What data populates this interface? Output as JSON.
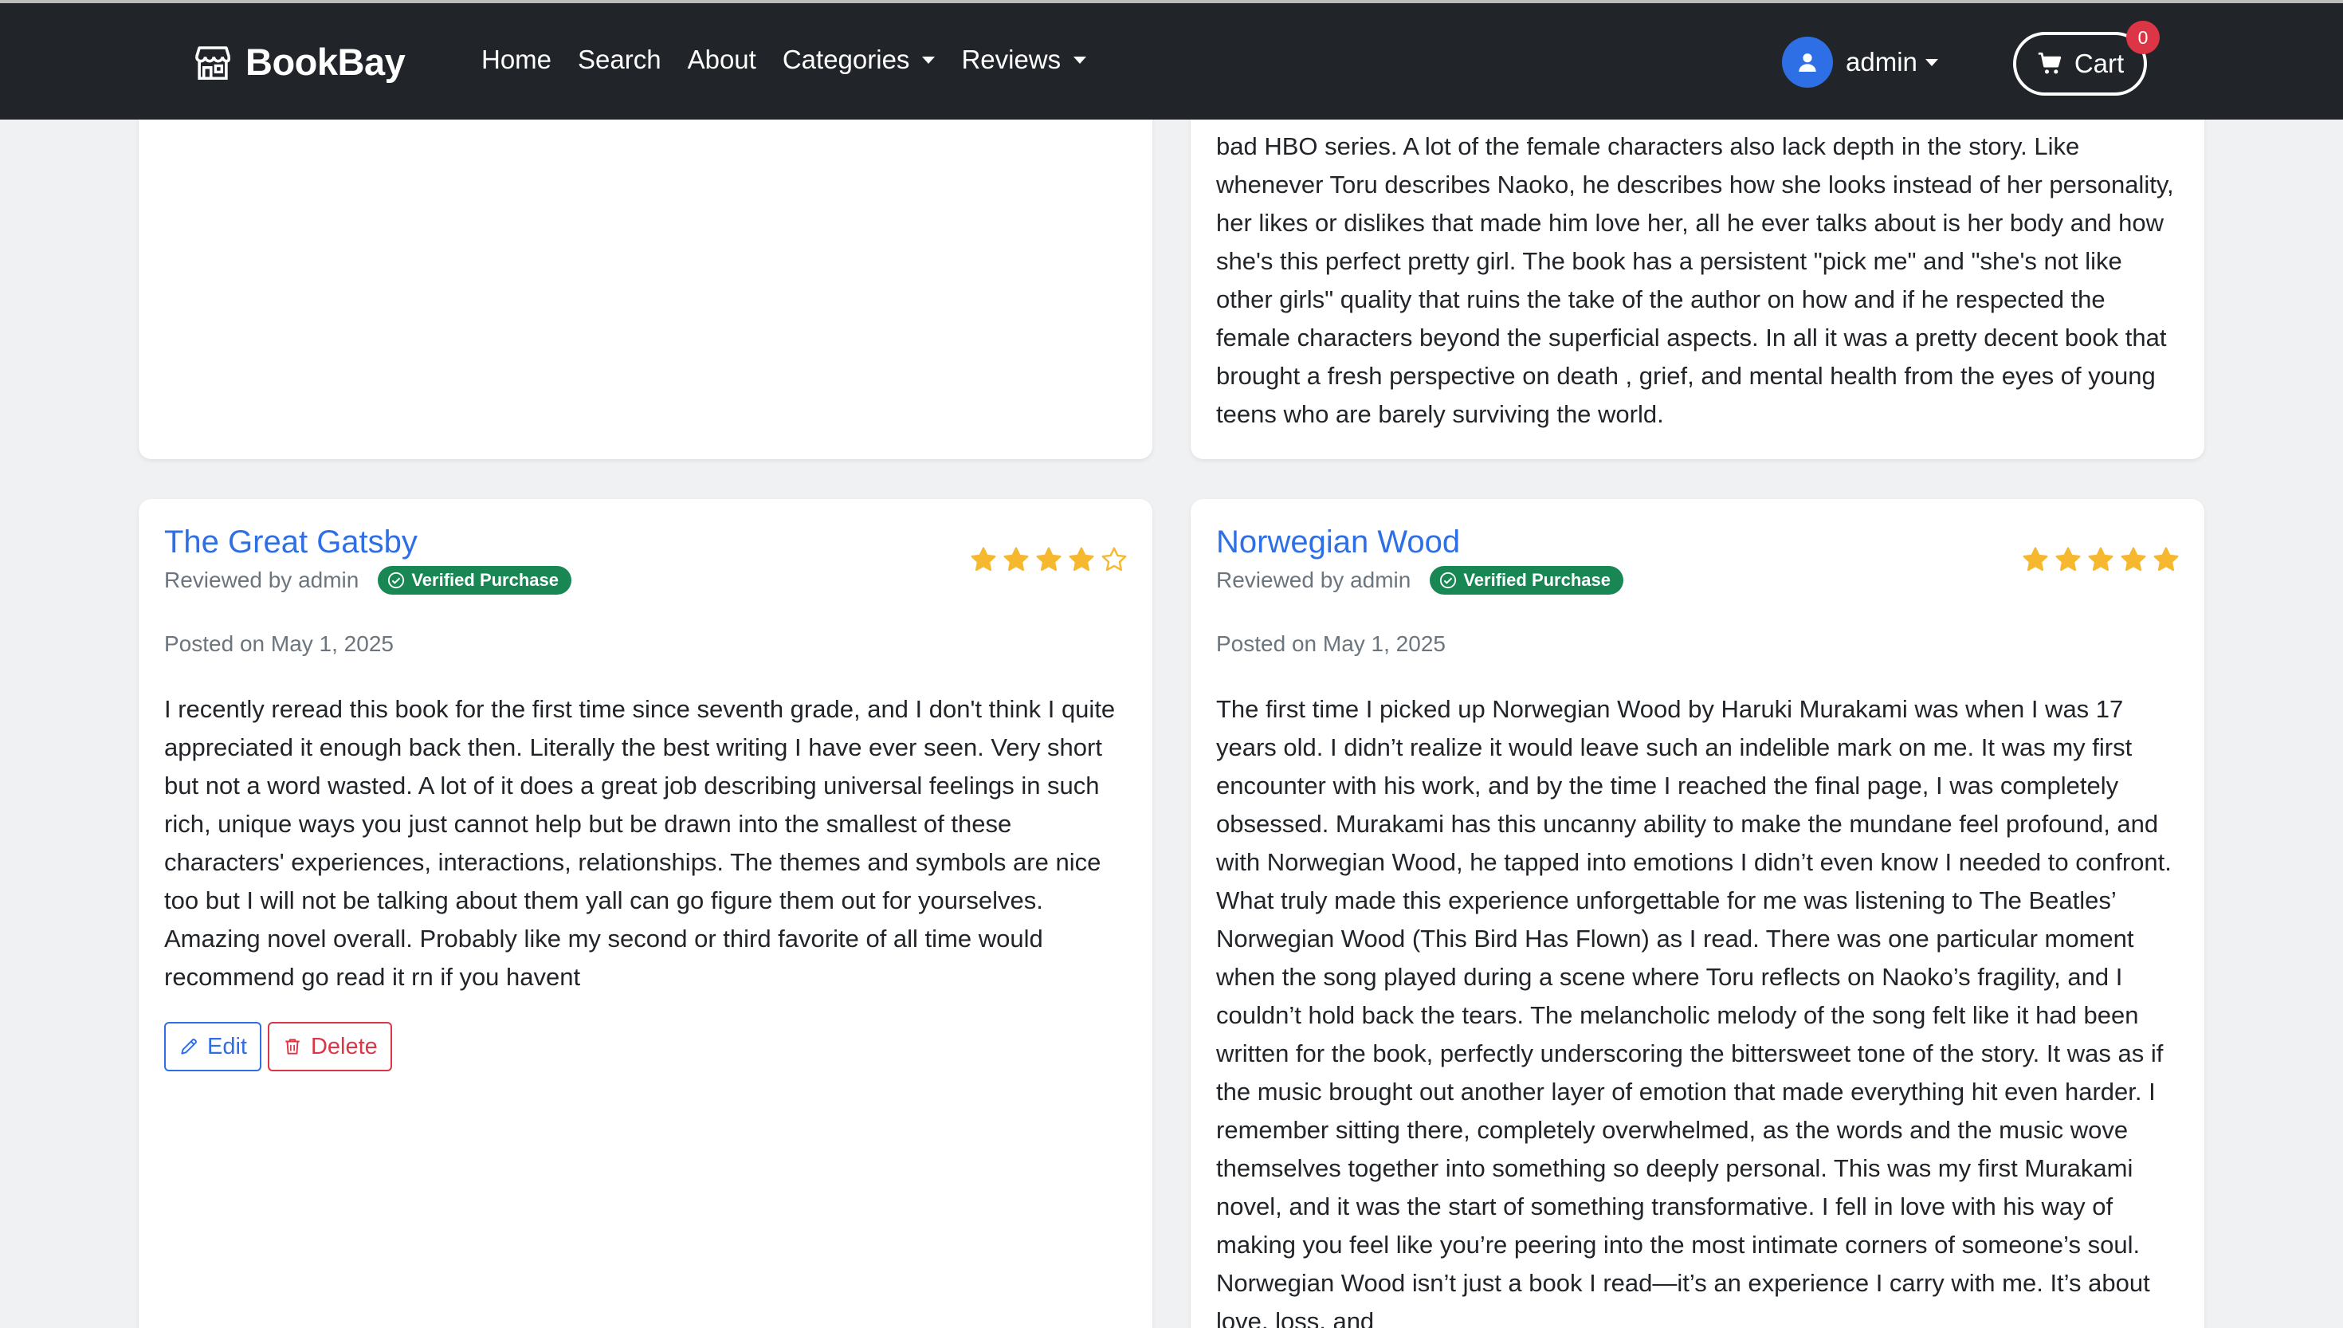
{
  "navbar": {
    "brand": "BookBay",
    "links": [
      {
        "label": "Home"
      },
      {
        "label": "Search"
      },
      {
        "label": "About"
      },
      {
        "label": "Categories"
      },
      {
        "label": "Reviews"
      }
    ],
    "user": {
      "name": "admin"
    },
    "cart": {
      "label": "Cart",
      "count": "0"
    }
  },
  "top_review": {
    "text": "bad HBO series. A lot of the female characters also lack depth in the story. Like whenever Toru describes Naoko, he describes how she looks instead of her personality, her likes or dislikes that made him love her, all he ever talks about is her body and how she's this perfect pretty girl. The book has a persistent \"pick me\" and \"she's not like other girls\" quality that ruins the take of the author on how and if he respected the female characters beyond the superficial aspects. In all it was a pretty decent book that brought a fresh perspective on death , grief, and mental health from the eyes of young teens who are barely surviving the world."
  },
  "reviews": [
    {
      "title": "The Great Gatsby",
      "byline": "Reviewed by admin",
      "badge": "Verified Purchase",
      "rating": 4,
      "posted": "Posted on May 1, 2025",
      "text": "I recently reread this book for the first time since seventh grade, and I don't think I quite appreciated it enough back then. Literally the best writing I have ever seen. Very short but not a word wasted. A lot of it does a great job describing universal feelings in such rich, unique ways you just cannot help but be drawn into the smallest of these characters' experiences, interactions, relationships. The themes and symbols are nice too but I will not be talking about them yall can go figure them out for yourselves. Amazing novel overall. Probably like my second or third favorite of all time would recommend go read it rn if you havent",
      "edit_label": "Edit",
      "delete_label": "Delete"
    },
    {
      "title": "Norwegian Wood",
      "byline": "Reviewed by admin",
      "badge": "Verified Purchase",
      "rating": 5,
      "posted": "Posted on May 1, 2025",
      "text": "The first time I picked up Norwegian Wood by Haruki Murakami was when I was 17 years old. I didn’t realize it would leave such an indelible mark on me. It was my first encounter with his work, and by the time I reached the final page, I was completely obsessed. Murakami has this uncanny ability to make the mundane feel profound, and with Norwegian Wood, he tapped into emotions I didn’t even know I needed to confront. What truly made this experience unforgettable for me was listening to The Beatles’ Norwegian Wood (This Bird Has Flown) as I read. There was one particular moment when the song played during a scene where Toru reflects on Naoko’s fragility, and I couldn’t hold back the tears. The melancholic melody of the song felt like it had been written for the book, perfectly underscoring the bittersweet tone of the story. It was as if the music brought out another layer of emotion that made everything hit even harder. I remember sitting there, completely overwhelmed, as the words and the music wove themselves together into something so deeply personal. This was my first Murakami novel, and it was the start of something transformative. I fell in love with his way of making you feel like you’re peering into the most intimate corners of someone’s soul. Norwegian Wood isn’t just a book I read—it’s an experience I carry with me. It’s about love, loss, and"
    }
  ],
  "colors": {
    "navbar": "#212529",
    "link": "#2f6fe6",
    "verified": "#198754",
    "star": "#f5b82e",
    "danger": "#dc3545"
  }
}
